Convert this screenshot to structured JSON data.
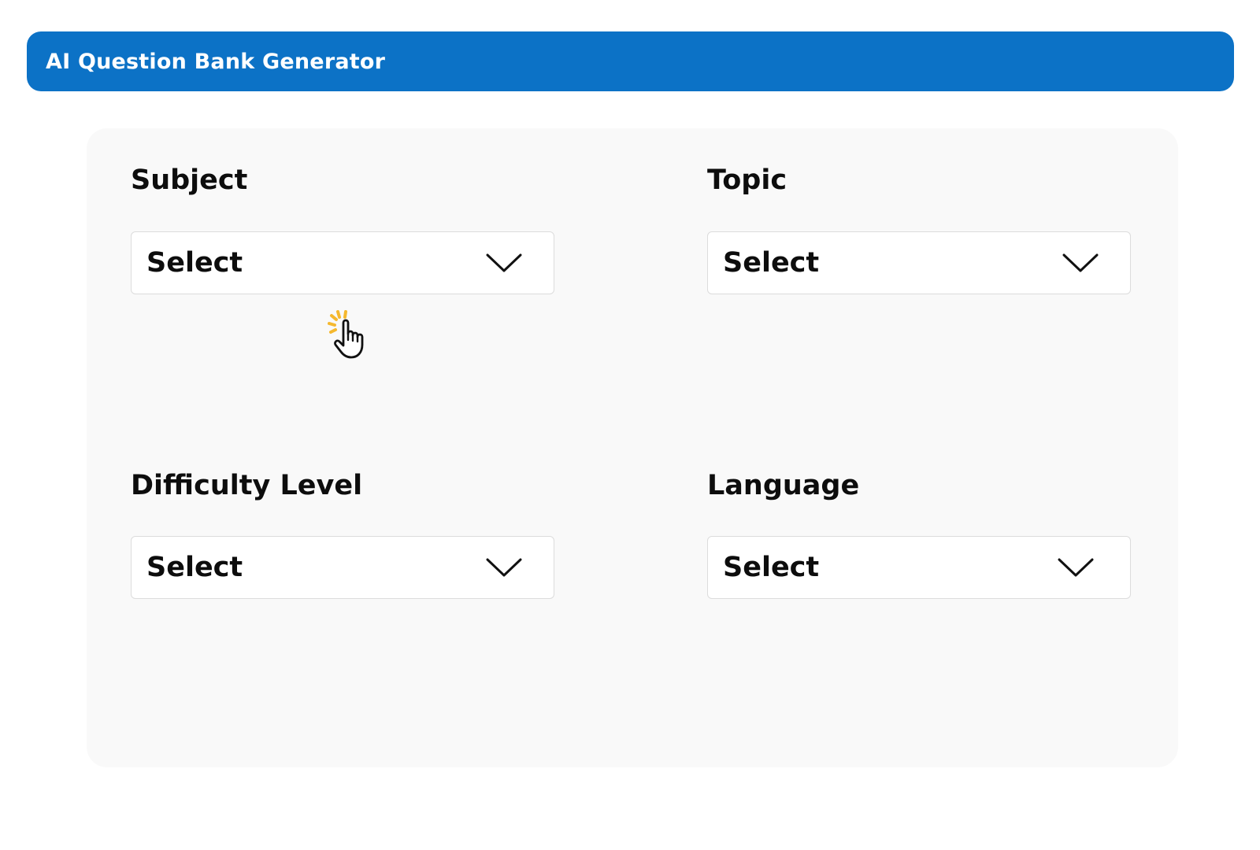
{
  "header": {
    "title": "AI Question Bank Generator"
  },
  "form": {
    "subject": {
      "label": "Subject",
      "value": "Select"
    },
    "topic": {
      "label": "Topic",
      "value": "Select"
    },
    "difficulty": {
      "label": "Difficulty Level",
      "value": "Select"
    },
    "language": {
      "label": "Language",
      "value": "Select"
    }
  },
  "icons": {
    "dropdown": "chevron-down-icon",
    "cursor": "hand-pointer-click-icon"
  },
  "colors": {
    "header_background": "#0c72c6",
    "header_text": "#ffffff",
    "panel_background": "#f9f9f9",
    "click_burst": "#f5b82e"
  }
}
